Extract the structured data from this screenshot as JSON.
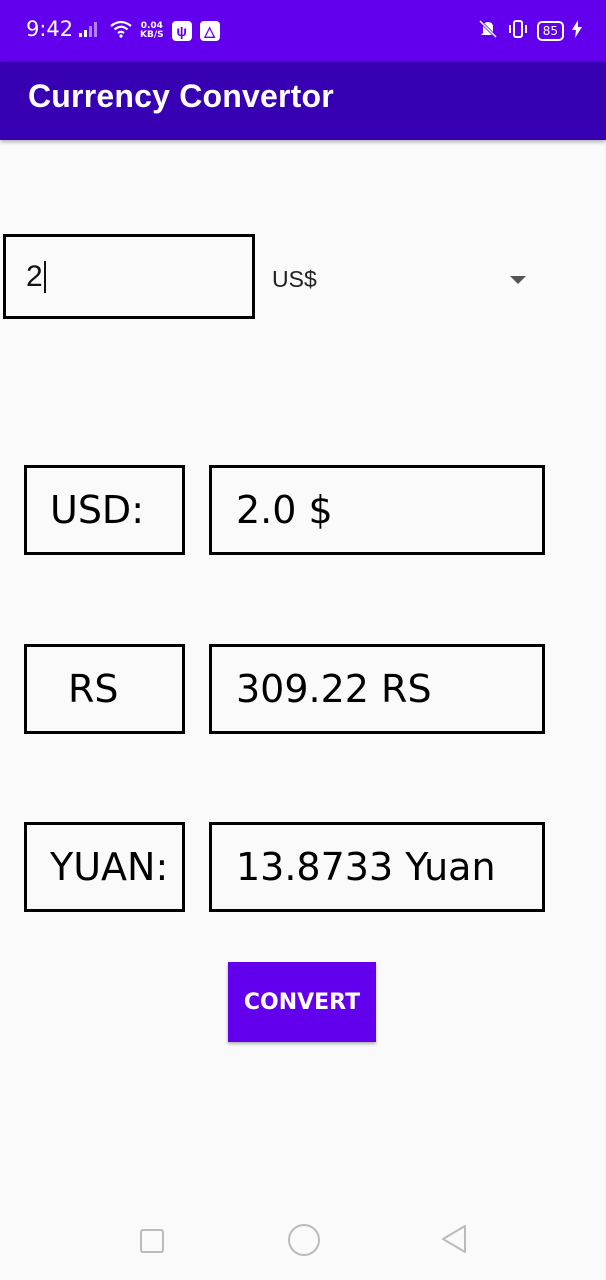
{
  "status_bar": {
    "time": "9:42",
    "net_speed_value": "0.04",
    "net_speed_unit": "KB/S",
    "battery": "85"
  },
  "app_bar": {
    "title": "Currency Convertor"
  },
  "input": {
    "amount": "2",
    "currency_selected": "US$"
  },
  "results": [
    {
      "label": "USD:",
      "value": "2.0 $"
    },
    {
      "label": "RS",
      "value": "309.22 RS"
    },
    {
      "label": "YUAN:",
      "value": "13.8733 Yuan"
    }
  ],
  "convert_button": {
    "label": "CONVERT"
  },
  "colors": {
    "status_bar": "#6200ee",
    "app_bar": "#3700b3",
    "accent": "#6200ee",
    "background": "#fafafa"
  },
  "icons": [
    "signal-icon",
    "wifi-icon",
    "usb-icon",
    "drive-icon",
    "mute-icon",
    "vibrate-icon",
    "battery-icon",
    "charging-icon",
    "nav-recent-icon",
    "nav-home-icon",
    "nav-back-icon"
  ]
}
